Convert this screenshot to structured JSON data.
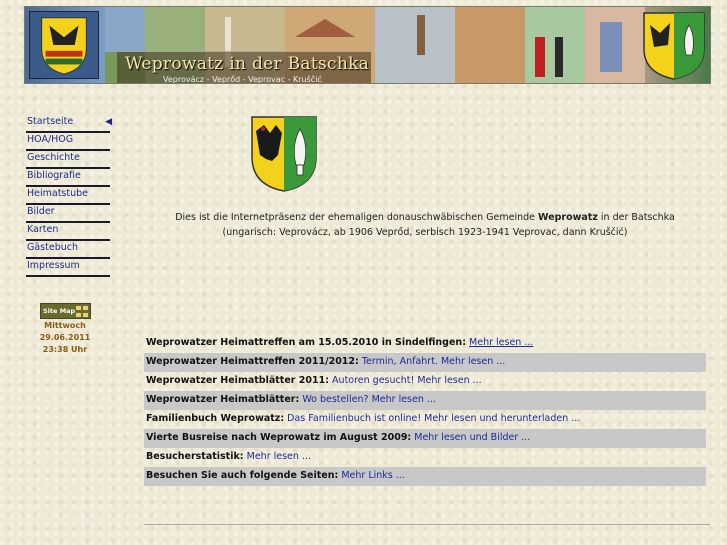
{
  "header": {
    "title": "Weprowatz in der Batschka",
    "subtitle": "Veprovácz - Veprőd - Veprovac - Kruščić"
  },
  "nav": {
    "items": [
      {
        "label": "Startseite",
        "active": true
      },
      {
        "label": "HOA/HOG"
      },
      {
        "label": "Geschichte"
      },
      {
        "label": "Bibliografie"
      },
      {
        "label": "Heimatstube"
      },
      {
        "label": "Bilder"
      },
      {
        "label": "Karten"
      },
      {
        "label": "Gästebuch"
      },
      {
        "label": "Impressum"
      }
    ],
    "active_arrow": "◀"
  },
  "sidebar": {
    "sitemap_label": "Site Map",
    "weekday": "Mittwoch",
    "date": "29.06.2011",
    "time": "23:38 Uhr"
  },
  "intro": {
    "line1_pre": "Dies ist die Internetpräsenz der ehemaligen donauschwäbischen Gemeinde ",
    "line1_bold": "Weprowatz",
    "line1_post": " in der Batschka",
    "line2": "(ungarisch: Veprovácz, ab 1906 Veprőd, serbisch 1923-1941 Veprovac, dann Kruščić)"
  },
  "news": [
    {
      "title": "Weprowatzer Heimattreffen am 15.05.2010 in Sindelfingen:",
      "link": "Mehr lesen ..."
    },
    {
      "title": "Weprowatzer Heimattreffen 2011/2012:",
      "link": "Termin, Anfahrt. Mehr lesen ..."
    },
    {
      "title": "Weprowatzer Heimatblätter 2011:",
      "link": "Autoren gesucht! Mehr lesen ..."
    },
    {
      "title": "Weprowatzer Heimatblätter:",
      "link": "Wo bestellen? Mehr lesen ..."
    },
    {
      "title": "Familienbuch Weprowatz:",
      "link": "Das Familienbuch ist online! Mehr lesen und herunterladen ..."
    },
    {
      "title": "Vierte Busreise nach Weprowatz im August 2009:",
      "link": "Mehr lesen und Bilder ..."
    },
    {
      "title": "Besucherstatistik:",
      "link": "Mehr lesen ..."
    },
    {
      "title": "Besuchen Sie auch folgende Seiten:",
      "link": "Mehr Links ..."
    }
  ],
  "colors": {
    "link": "#1a2a9a",
    "nav_link": "#1a2a8a",
    "date_text": "#8a5a10",
    "row_shade": "#c8c8c8",
    "crest_yellow": "#f2d21a",
    "crest_green": "#3a9a3a"
  }
}
